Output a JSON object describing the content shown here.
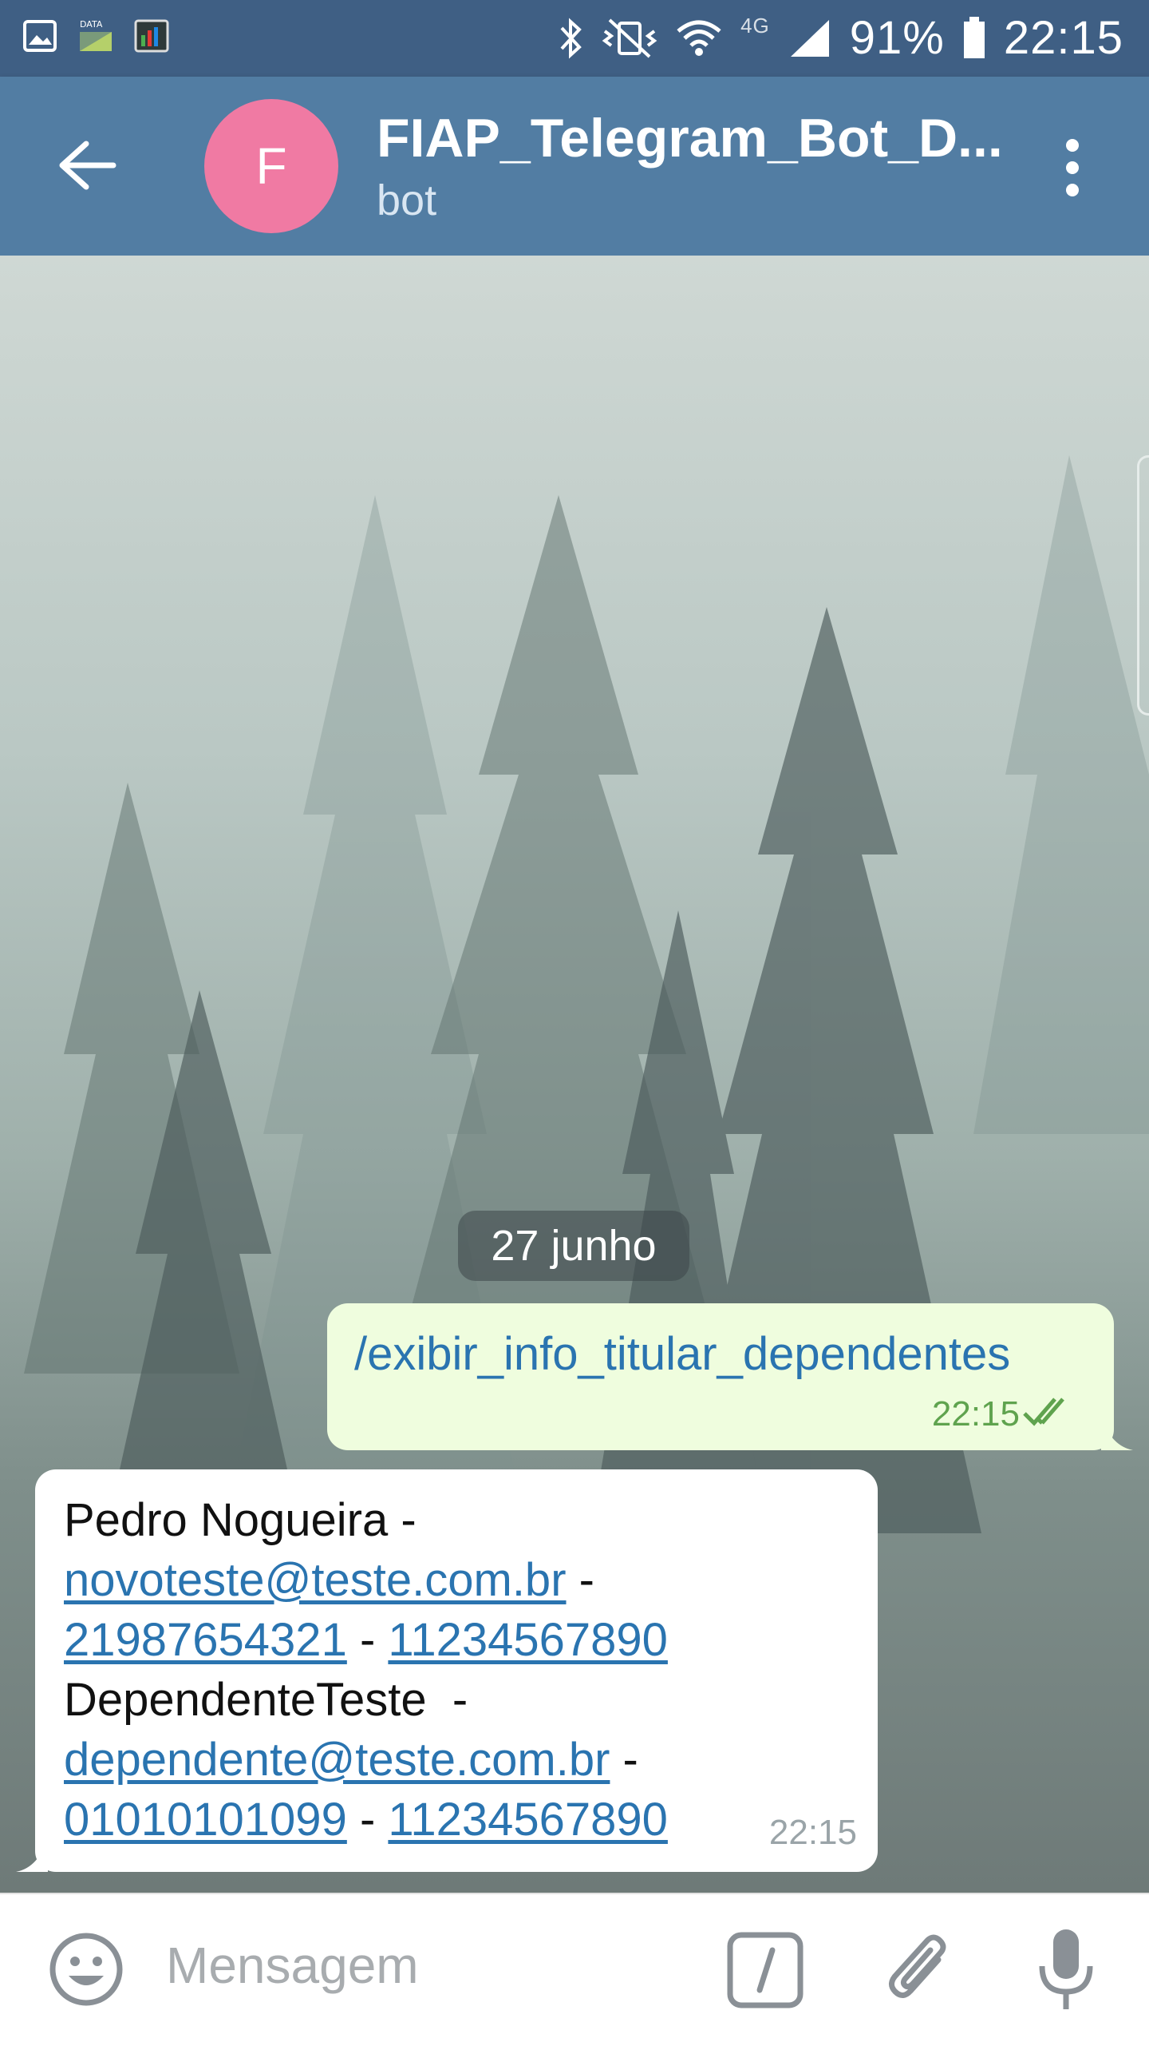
{
  "status_bar": {
    "battery": "91%",
    "time": "22:15",
    "network": "4G",
    "icons": [
      "gallery-icon",
      "data-icon",
      "monitor-icon",
      "bluetooth-icon",
      "vibrate-icon",
      "wifi-icon",
      "signal-icon",
      "battery-icon"
    ]
  },
  "header": {
    "avatar_letter": "F",
    "title": "FIAP_Telegram_Bot_D...",
    "subtitle": "bot",
    "avatar_color": "#f07aa3",
    "bar_color": "#527da3"
  },
  "chat": {
    "date_label": "27 junho",
    "outgoing": {
      "text": "/exibir_info_titular_dependentes",
      "time": "22:15"
    },
    "incoming": {
      "line1": "Pedro Nogueira -",
      "email1": "novoteste@teste.com.br",
      "sep": " - ",
      "phone1a": "21987654321",
      "phone1b": "11234567890",
      "line4": "DependenteTeste  -",
      "email2": "dependente@teste.com.br",
      "phone2a": "01010101099",
      "phone2b": "11234567890",
      "dash": " -",
      "mid_dash": " - ",
      "time": "22:15"
    }
  },
  "input_bar": {
    "placeholder": "Mensagem"
  }
}
